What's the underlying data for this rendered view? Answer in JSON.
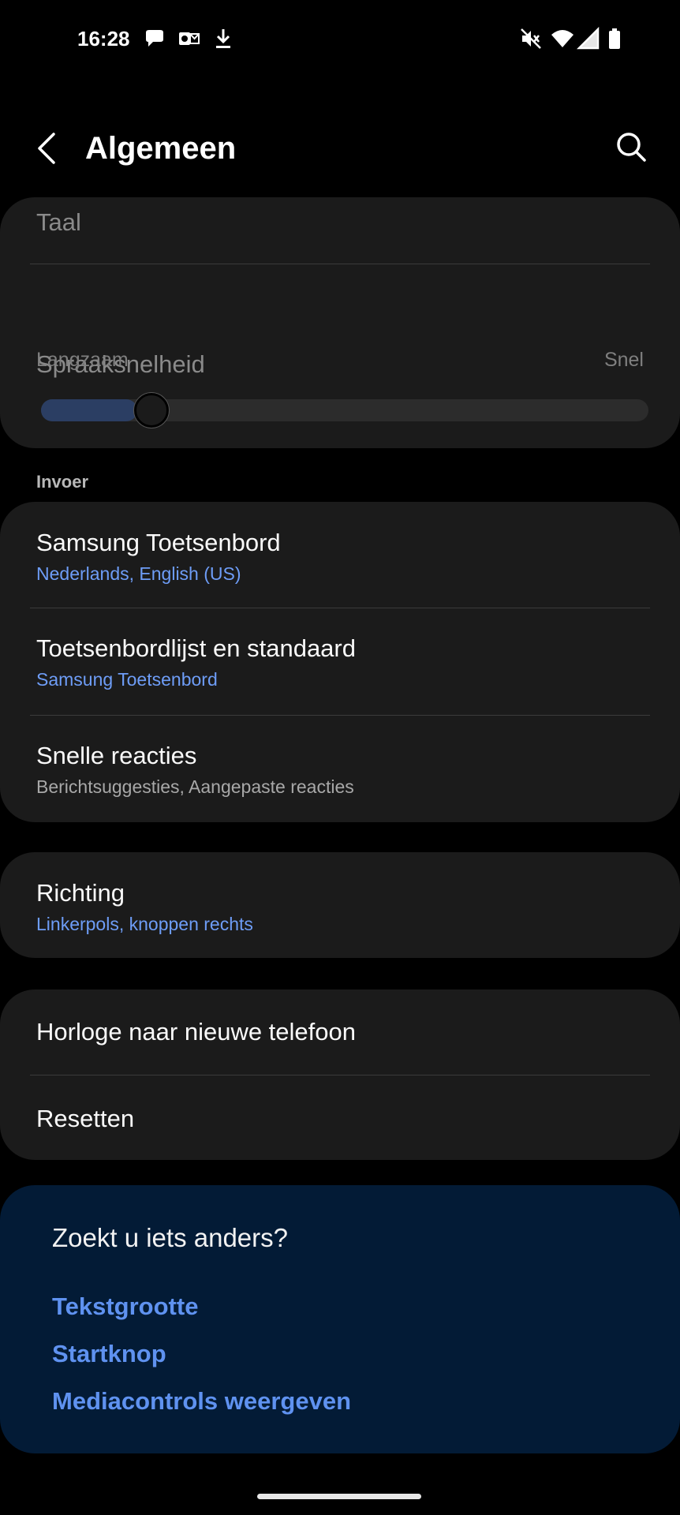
{
  "status_bar": {
    "time": "16:28",
    "left_icons": [
      "chat-bubble-icon",
      "outlook-icon",
      "download-icon"
    ],
    "right_icons": [
      "mute-icon",
      "wifi-icon",
      "signal-icon",
      "battery-icon"
    ]
  },
  "header": {
    "title": "Algemeen",
    "back_icon": "chevron-left-icon",
    "search_icon": "search-icon"
  },
  "speech_card": {
    "language_label": "Taal",
    "speed_label": "Spraaksnelheid",
    "slider": {
      "min_label": "Langzaam",
      "max_label": "Snel",
      "value_fraction": 0.15
    }
  },
  "input_section": {
    "label": "Invoer",
    "items": [
      {
        "title": "Samsung Toetsenbord",
        "subtitle": "Nederlands, English (US)"
      },
      {
        "title": "Toetsenbordlijst en standaard",
        "subtitle": "Samsung Toetsenbord"
      },
      {
        "title": "Snelle reacties",
        "subtitle": "Berichtsuggesties, Aangepaste reacties"
      }
    ]
  },
  "orientation_card": {
    "title": "Richting",
    "subtitle": "Linkerpols, knoppen rechts"
  },
  "device_card": {
    "items": [
      {
        "title": "Horloge naar nieuwe telefoon"
      },
      {
        "title": "Resetten"
      }
    ]
  },
  "suggestions": {
    "title": "Zoekt u iets anders?",
    "links": [
      "Tekstgrootte",
      "Startknop",
      "Mediacontrols weergeven"
    ]
  },
  "colors": {
    "accent_blue": "#6e9df7",
    "link_blue": "#5f92f0",
    "card_bg": "#1b1b1b",
    "suggest_bg": "#031b36"
  }
}
